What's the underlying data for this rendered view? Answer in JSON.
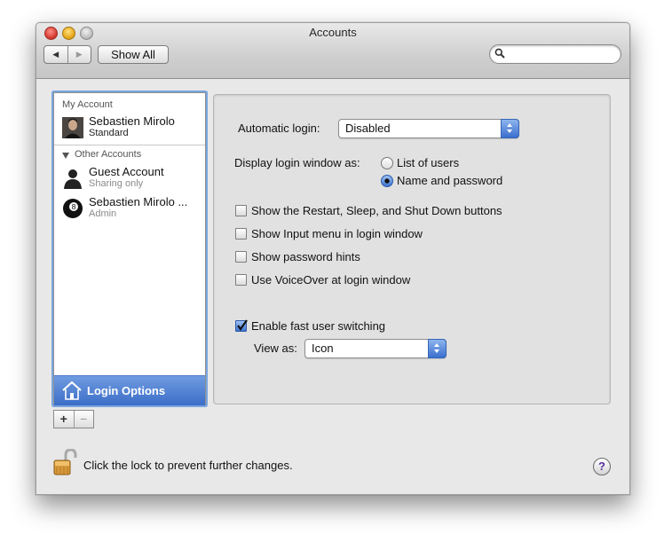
{
  "window": {
    "title": "Accounts"
  },
  "toolbar": {
    "back_glyph": "◀",
    "forward_glyph": "▶",
    "show_all_label": "Show All",
    "search_placeholder": "",
    "search_value": ""
  },
  "sidebar": {
    "my_account_header": "My Account",
    "other_accounts_header": "Other Accounts",
    "accounts": [
      {
        "name": "Sebastien Mirolo",
        "role": "Standard",
        "icon": "user-photo-icon"
      },
      {
        "name": "Guest Account",
        "role": "Sharing only",
        "icon": "guest-silhouette-icon"
      },
      {
        "name": "Sebastien Mirolo ...",
        "role": "Admin",
        "icon": "eight-ball-icon"
      }
    ],
    "login_options_label": "Login Options",
    "add_glyph": "+",
    "remove_glyph": "−"
  },
  "options": {
    "automatic_login_label": "Automatic login:",
    "automatic_login_value": "Disabled",
    "display_login_label": "Display login window as:",
    "radio_list_label": "List of users",
    "radio_name_label": "Name and password",
    "radio_selected": "Name and password",
    "checkboxes": [
      {
        "label": "Show the Restart, Sleep, and Shut Down buttons",
        "checked": false
      },
      {
        "label": "Show Input menu in login window",
        "checked": false
      },
      {
        "label": "Show password hints",
        "checked": false
      },
      {
        "label": "Use VoiceOver at login window",
        "checked": false
      },
      {
        "label": "Enable fast user switching",
        "checked": true
      }
    ],
    "view_as_label": "View as:",
    "view_as_value": "Icon"
  },
  "footer": {
    "lock_text": "Click the lock to prevent further changes.",
    "help_glyph": "?"
  },
  "colors": {
    "selection_blue": "#3c6ec8",
    "close": "#d43a30",
    "minimize": "#e5a51a",
    "zoom": "#bdbdbd"
  }
}
